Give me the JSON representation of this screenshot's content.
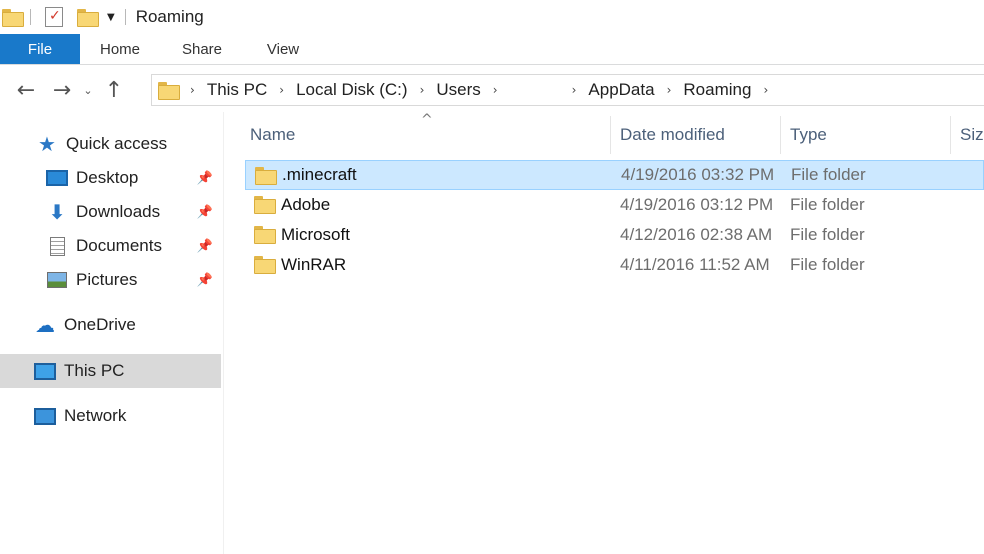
{
  "window": {
    "title": "Roaming"
  },
  "ribbon": {
    "tabs": [
      {
        "label": "File"
      },
      {
        "label": "Home"
      },
      {
        "label": "Share"
      },
      {
        "label": "View"
      }
    ]
  },
  "navigation": {
    "back_glyph": "←",
    "forward_glyph": "→",
    "recent_glyph": "⌄",
    "up_glyph": "↑",
    "separator_glyph": "›"
  },
  "address": {
    "crumbs": [
      "This PC",
      "Local Disk (C:)",
      "Users",
      "",
      "AppData",
      "Roaming"
    ]
  },
  "nav_pane": {
    "quick_access": "Quick access",
    "items": [
      {
        "label": "Desktop",
        "icon": "desktop-icon",
        "pinned": true
      },
      {
        "label": "Downloads",
        "icon": "downloads-icon",
        "pinned": true
      },
      {
        "label": "Documents",
        "icon": "documents-icon",
        "pinned": true
      },
      {
        "label": "Pictures",
        "icon": "pictures-icon",
        "pinned": true
      }
    ],
    "onedrive": "OneDrive",
    "this_pc": "This PC",
    "network": "Network"
  },
  "columns": {
    "name": "Name",
    "date_modified": "Date modified",
    "type": "Type",
    "size": "Size"
  },
  "files": [
    {
      "name": ".minecraft",
      "date": "4/19/2016 03:32 PM",
      "type": "File folder",
      "selected": true
    },
    {
      "name": "Adobe",
      "date": "4/19/2016 03:12 PM",
      "type": "File folder",
      "selected": false
    },
    {
      "name": "Microsoft",
      "date": "4/12/2016 02:38 AM",
      "type": "File folder",
      "selected": false
    },
    {
      "name": "WinRAR",
      "date": "4/11/2016 11:52 AM",
      "type": "File folder",
      "selected": false
    }
  ],
  "colors": {
    "accent": "#1979ca",
    "selection_bg": "#cce8ff",
    "selection_border": "#99d1ff",
    "folder": "#f8d775"
  }
}
